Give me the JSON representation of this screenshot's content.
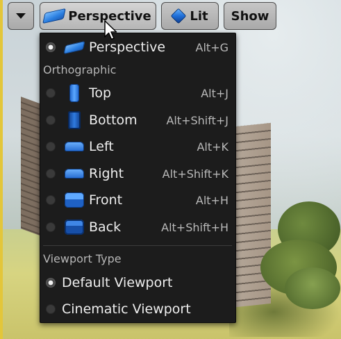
{
  "toolbar": {
    "options_icon": "caret-down-icon",
    "perspective_label": "Perspective",
    "perspective_icon": "perspective-view-icon",
    "lit_label": "Lit",
    "lit_icon": "lit-cube-icon",
    "show_label": "Show"
  },
  "menu": {
    "items": [
      {
        "label": "Perspective",
        "shortcut": "Alt+G",
        "icon": "perspective-view-icon",
        "selected": true
      },
      {
        "label": "Top",
        "shortcut": "Alt+J",
        "icon": "top-view-icon",
        "selected": false
      },
      {
        "label": "Bottom",
        "shortcut": "Alt+Shift+J",
        "icon": "bottom-view-icon",
        "selected": false
      },
      {
        "label": "Left",
        "shortcut": "Alt+K",
        "icon": "left-view-icon",
        "selected": false
      },
      {
        "label": "Right",
        "shortcut": "Alt+Shift+K",
        "icon": "right-view-icon",
        "selected": false
      },
      {
        "label": "Front",
        "shortcut": "Alt+H",
        "icon": "front-view-icon",
        "selected": false
      },
      {
        "label": "Back",
        "shortcut": "Alt+Shift+H",
        "icon": "back-view-icon",
        "selected": false
      }
    ],
    "orthographic_header": "Orthographic",
    "viewport_type_header": "Viewport Type",
    "viewport_types": [
      {
        "label": "Default Viewport",
        "selected": true
      },
      {
        "label": "Cinematic Viewport",
        "selected": false
      }
    ]
  },
  "colors": {
    "menu_bg": "#1c1c1c",
    "accent_blue": "#2a7ee0",
    "toolbar_button": "#b4b4b4"
  }
}
